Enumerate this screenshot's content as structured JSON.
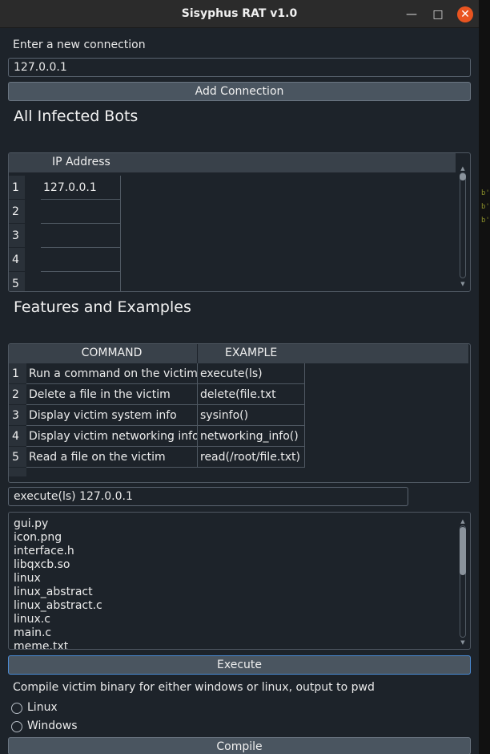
{
  "window": {
    "title": "Sisyphus RAT v1.0"
  },
  "connection": {
    "label": "Enter a new connection",
    "input_value": "127.0.0.1",
    "add_button": "Add Connection"
  },
  "bots": {
    "heading": "All Infected Bots",
    "column_header": "IP Address",
    "rows": [
      {
        "num": "1",
        "ip": "127.0.0.1"
      },
      {
        "num": "2",
        "ip": ""
      },
      {
        "num": "3",
        "ip": ""
      },
      {
        "num": "4",
        "ip": ""
      },
      {
        "num": "5",
        "ip": ""
      }
    ]
  },
  "features": {
    "heading": "Features and Examples",
    "columns": [
      "COMMAND",
      "EXAMPLE"
    ],
    "rows": [
      {
        "num": "1",
        "command": "Run a command on the victim",
        "example": "execute(ls)"
      },
      {
        "num": "2",
        "command": "Delete a file in the victim",
        "example": "delete(file.txt"
      },
      {
        "num": "3",
        "command": "Display victim system info",
        "example": "sysinfo()"
      },
      {
        "num": "4",
        "command": "Display victim networking info",
        "example": "networking_info()"
      },
      {
        "num": "5",
        "command": "Read a file on the victim",
        "example": "read(/root/file.txt)"
      }
    ]
  },
  "command": {
    "input_value": "execute(ls) 127.0.0.1",
    "output_lines": [
      "gui.py",
      "icon.png",
      "interface.h",
      "libqxcb.so",
      "linux",
      "linux_abstract",
      "linux_abstract.c",
      "linux.c",
      "main.c",
      "meme.txt"
    ],
    "execute_button": "Execute"
  },
  "compile": {
    "label": "Compile victim binary for either windows or linux, output to pwd",
    "options": [
      "Linux",
      "Windows"
    ],
    "compile_button": "Compile"
  },
  "background_fragments": [
    "b'",
    "b'",
    "b'"
  ],
  "icons": {
    "minimize": "minimize-icon",
    "maximize": "maximize-icon",
    "close": "close-icon"
  },
  "colors": {
    "background": "#1d232a",
    "close_button": "#e95420",
    "header": "#39414a",
    "button": "#4a5560",
    "focus": "#4b8bd4"
  }
}
